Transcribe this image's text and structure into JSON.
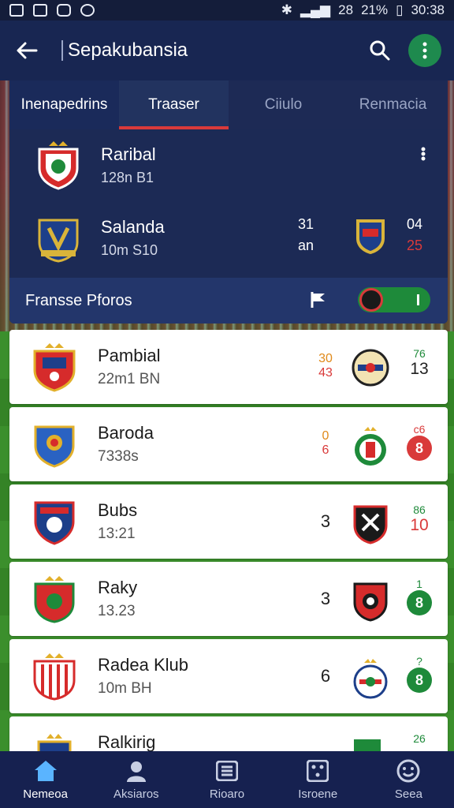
{
  "status_bar": {
    "left_icons": [
      "image-icon",
      "gallery-icon",
      "message-icon",
      "sync-icon"
    ],
    "signal": "28",
    "battery": "21%",
    "time": "30:38"
  },
  "app_bar": {
    "title": "Sepakubansia"
  },
  "tabs": [
    {
      "label": "Inenapedrins"
    },
    {
      "label": "Traaser"
    },
    {
      "label": "Ciiulo"
    },
    {
      "label": "Renmacia"
    }
  ],
  "featured": {
    "team1": {
      "name": "Raribal",
      "sub": "128n B1"
    },
    "team2": {
      "name": "Salanda",
      "sub": "10m S10"
    },
    "score_a": {
      "top": "31",
      "bot": "an"
    },
    "score_b": {
      "top": "04",
      "bot": "25"
    },
    "footer_label": "Fransse Pforos",
    "toggle_mark": "I"
  },
  "matches": [
    {
      "name": "Pambial",
      "time": "22m1 BN",
      "score_top": "30",
      "score_bot": "43",
      "right_top": "76",
      "right_bot": "13",
      "badge": ""
    },
    {
      "name": "Baroda",
      "time": "7338s",
      "score_top": "0",
      "score_bot": "6",
      "right_top": "c6",
      "right_bot": "",
      "badge": "8"
    },
    {
      "name": "Bubs",
      "time": "13:21",
      "score_top": "",
      "score_bot": "3",
      "right_top": "86",
      "right_bot": "10",
      "badge": ""
    },
    {
      "name": "Raky",
      "time": "13.23",
      "score_top": "",
      "score_bot": "3",
      "right_top": "1",
      "right_bot": "",
      "badge": "8"
    },
    {
      "name": "Radea Klub",
      "time": "10m BH",
      "score_top": "",
      "score_bot": "6",
      "right_top": "?",
      "right_bot": "",
      "badge": "8"
    },
    {
      "name": "Ralkirig",
      "time": "",
      "score_top": "",
      "score_bot": "",
      "right_top": "26",
      "right_bot": "",
      "badge": ""
    }
  ],
  "bottom_nav": [
    {
      "label": "Nemeoa",
      "icon": "home-icon"
    },
    {
      "label": "Aksiaros",
      "icon": "person-icon"
    },
    {
      "label": "Rioaro",
      "icon": "list-icon"
    },
    {
      "label": "Isroene",
      "icon": "dice-icon"
    },
    {
      "label": "Seea",
      "icon": "smile-icon"
    }
  ],
  "colors": {
    "primary": "#182652",
    "accent_green": "#1e8a4e",
    "accent_red": "#d93a3a"
  }
}
